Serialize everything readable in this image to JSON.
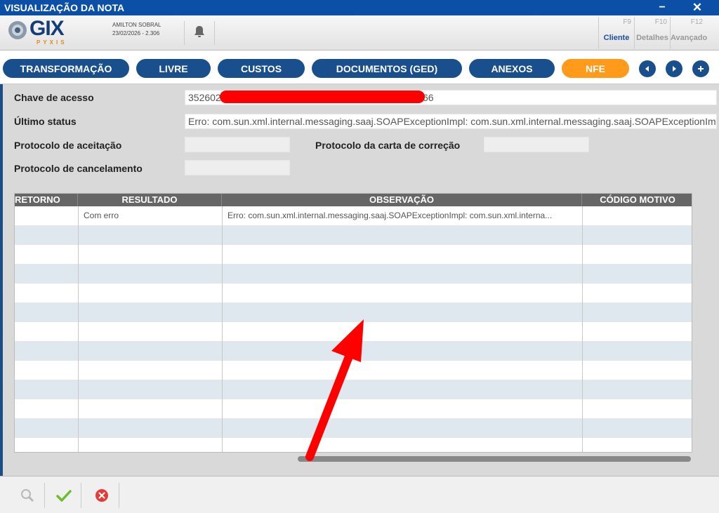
{
  "window": {
    "title": "VISUALIZAÇÃO DA NOTA",
    "minimize_label": "−",
    "close_label": "✕"
  },
  "header": {
    "brand": "GIX",
    "brand_sub": "PYXIS",
    "user_name": "AMILTON SOBRAL",
    "user_date_version": "23/02/2026 - 2.306",
    "fkeys": [
      {
        "key": "F9",
        "label": "Cliente"
      },
      {
        "key": "F10",
        "label": "Detalhes"
      },
      {
        "key": "F12",
        "label": "Avançado"
      }
    ]
  },
  "tabs": [
    {
      "label": "TRANSFORMAÇÃO"
    },
    {
      "label": "LIVRE"
    },
    {
      "label": "CUSTOS"
    },
    {
      "label": "DOCUMENTOS (GED)"
    },
    {
      "label": "ANEXOS"
    },
    {
      "label": "NFE"
    }
  ],
  "form": {
    "chave_label": "Chave de acesso",
    "chave_prefix": "352602",
    "chave_suffix": "66",
    "status_label": "Último status",
    "status_value": "Erro: com.sun.xml.internal.messaging.saaj.SOAPExceptionImpl: com.sun.xml.internal.messaging.saaj.SOAPExceptionImpl: com.sun.xml",
    "aceitacao_label": "Protocolo de aceitação",
    "carta_label": "Protocolo da carta de correção",
    "cancelamento_label": "Protocolo de cancelamento"
  },
  "table": {
    "columns": [
      "RETORNO",
      "RESULTADO",
      "OBSERVAÇÃO",
      "CÓDIGO MOTIVO"
    ],
    "rows": [
      {
        "retorno": "",
        "resultado": "Com erro",
        "observacao": "Erro: com.sun.xml.internal.messaging.saaj.SOAPExceptionImpl: com.sun.xml.interna...",
        "codigo": ""
      }
    ]
  },
  "colors": {
    "title_bar": "#0b4fa6",
    "tab_blue": "#1a4f8e",
    "tab_active": "#ff9a1a",
    "annotation_red": "#ff0000"
  }
}
